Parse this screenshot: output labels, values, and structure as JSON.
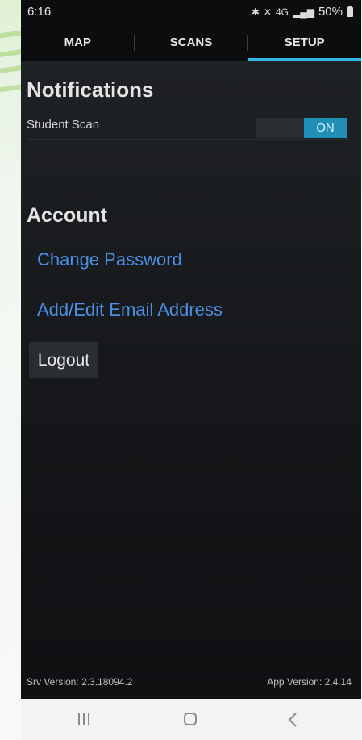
{
  "status_bar": {
    "time": "6:16",
    "battery": "50%",
    "icons": [
      "bluetooth-icon",
      "mute-icon",
      "lte-icon",
      "signal-icon",
      "battery-icon"
    ],
    "network_label": "4G"
  },
  "tabs": [
    {
      "label": "MAP",
      "active": false
    },
    {
      "label": "SCANS",
      "active": false
    },
    {
      "label": "SETUP",
      "active": true
    }
  ],
  "notifications": {
    "title": "Notifications",
    "student_scan_label": "Student Scan",
    "toggle_state": "ON"
  },
  "account": {
    "title": "Account",
    "change_password": "Change Password",
    "add_edit_email": "Add/Edit Email Address",
    "logout": "Logout"
  },
  "versions": {
    "srv": "Srv Version: 2.3.18094.2",
    "app": "App Version: 2.4.14"
  },
  "colors": {
    "accent": "#33b5e5",
    "toggle_on": "#1f8fb8",
    "link": "#4a8fe4",
    "background": "#16181b"
  },
  "nav_bar": {
    "icons": [
      "recent-apps-icon",
      "home-icon",
      "back-icon"
    ]
  }
}
